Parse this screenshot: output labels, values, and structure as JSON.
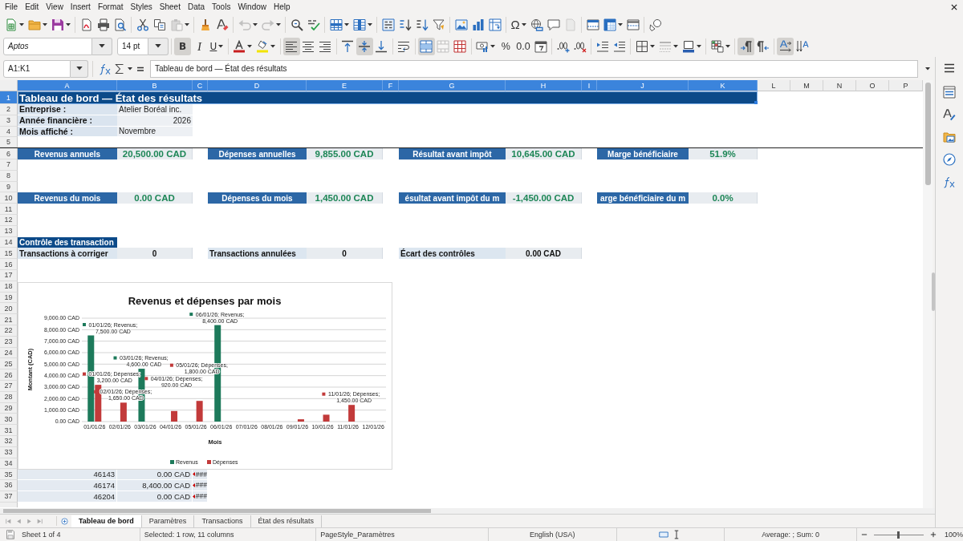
{
  "menu_bar": {
    "items": [
      "File",
      "Edit",
      "View",
      "Insert",
      "Format",
      "Styles",
      "Sheet",
      "Data",
      "Tools",
      "Window",
      "Help"
    ]
  },
  "standard_toolbar": {
    "buttons": [
      {
        "disabled": false
      },
      {
        "disabled": false
      },
      {
        "disabled": false
      },
      {
        "disabled": false
      },
      {
        "disabled": false
      },
      {
        "disabled": false
      },
      {
        "disabled": false
      },
      {
        "disabled": false
      },
      {
        "disabled": true
      },
      {
        "disabled": false
      },
      {
        "disabled": false
      },
      {
        "disabled": true
      },
      {
        "disabled": true
      },
      {
        "disabled": false
      },
      {
        "disabled": false
      },
      {
        "disabled": false
      },
      {
        "disabled": false
      },
      {
        "disabled": false
      },
      {
        "disabled": false
      },
      {
        "disabled": false
      },
      {
        "disabled": false
      },
      {
        "disabled": false
      },
      {
        "disabled": false
      },
      {
        "disabled": false
      },
      {
        "label": "Ω",
        "disabled": false
      },
      {
        "disabled": false
      },
      {
        "disabled": false
      },
      {
        "disabled": true
      },
      {
        "disabled": false
      },
      {
        "disabled": false
      },
      {
        "disabled": false
      },
      {
        "disabled": false
      }
    ]
  },
  "formatting_toolbar": {
    "font_name": "Aptos",
    "font_size": "14 pt",
    "buttons": [
      {
        "label": "B",
        "on": true,
        "disabled": false
      },
      {
        "label": "I",
        "on": false,
        "disabled": false
      },
      {
        "label": "U",
        "on": false,
        "disabled": false
      },
      {
        "on": false,
        "disabled": false
      },
      {
        "on": false,
        "disabled": false
      },
      {
        "on": true,
        "disabled": false
      },
      {
        "on": false,
        "disabled": false
      },
      {
        "on": false,
        "disabled": false
      },
      {
        "on": false,
        "disabled": false
      },
      {
        "on": true,
        "disabled": false
      },
      {
        "on": false,
        "disabled": false
      },
      {
        "on": false,
        "disabled": false
      },
      {
        "on": true,
        "disabled": false
      },
      {
        "on": false,
        "disabled": true
      },
      {
        "on": false,
        "disabled": false
      },
      {
        "on": false,
        "disabled": false
      },
      {
        "label": "%",
        "on": false,
        "disabled": false
      },
      {
        "label": "0.0",
        "on": false,
        "disabled": false
      },
      {
        "on": false,
        "disabled": false
      },
      {
        "on": false,
        "disabled": false
      },
      {
        "on": false,
        "disabled": false
      },
      {
        "on": false,
        "disabled": false
      },
      {
        "on": false,
        "disabled": false
      },
      {
        "on": false,
        "disabled": false
      },
      {
        "on": false,
        "disabled": true
      },
      {
        "on": false,
        "disabled": false
      },
      {
        "on": false,
        "disabled": false
      },
      {
        "on": true,
        "disabled": false
      },
      {
        "on": false,
        "disabled": false
      },
      {
        "on": true,
        "disabled": false
      },
      {
        "on": false,
        "disabled": false
      }
    ]
  },
  "formula_bar": {
    "name_box": "A1:K1",
    "content": "Tableau de bord — État des résultats"
  },
  "sheet": {
    "columns": [
      {
        "label": "A",
        "selected": true
      },
      {
        "label": "B",
        "selected": true
      },
      {
        "label": "C",
        "selected": true
      },
      {
        "label": "D",
        "selected": true
      },
      {
        "label": "E",
        "selected": true
      },
      {
        "label": "F",
        "selected": true
      },
      {
        "label": "G",
        "selected": true
      },
      {
        "label": "H",
        "selected": true
      },
      {
        "label": "I",
        "selected": true
      },
      {
        "label": "J",
        "selected": true
      },
      {
        "label": "K",
        "selected": true
      },
      {
        "label": "L",
        "selected": false
      },
      {
        "label": "M",
        "selected": false
      },
      {
        "label": "N",
        "selected": false
      },
      {
        "label": "O",
        "selected": false
      },
      {
        "label": "P",
        "selected": false
      }
    ],
    "rows": [
      {
        "label": "1",
        "selected": true
      },
      {
        "label": "2",
        "selected": false
      },
      {
        "label": "3",
        "selected": false
      },
      {
        "label": "4",
        "selected": false
      },
      {
        "label": "5",
        "selected": false
      },
      {
        "label": "6",
        "selected": false
      },
      {
        "label": "7",
        "selected": false
      },
      {
        "label": "8",
        "selected": false
      },
      {
        "label": "9",
        "selected": false
      },
      {
        "label": "10",
        "selected": false
      },
      {
        "label": "11",
        "selected": false
      },
      {
        "label": "12",
        "selected": false
      },
      {
        "label": "13",
        "selected": false
      },
      {
        "label": "14",
        "selected": false
      },
      {
        "label": "15",
        "selected": false
      },
      {
        "label": "16",
        "selected": false
      },
      {
        "label": "17",
        "selected": false
      },
      {
        "label": "18",
        "selected": false
      },
      {
        "label": "19",
        "selected": false
      },
      {
        "label": "20",
        "selected": false
      },
      {
        "label": "21",
        "selected": false
      },
      {
        "label": "22",
        "selected": false
      },
      {
        "label": "23",
        "selected": false
      },
      {
        "label": "24",
        "selected": false
      },
      {
        "label": "25",
        "selected": false
      },
      {
        "label": "26",
        "selected": false
      },
      {
        "label": "27",
        "selected": false
      },
      {
        "label": "28",
        "selected": false
      },
      {
        "label": "29",
        "selected": false
      },
      {
        "label": "30",
        "selected": false
      },
      {
        "label": "31",
        "selected": false
      },
      {
        "label": "32",
        "selected": false
      },
      {
        "label": "33",
        "selected": false
      },
      {
        "label": "34",
        "selected": false
      },
      {
        "label": "35",
        "selected": false
      },
      {
        "label": "36",
        "selected": false
      },
      {
        "label": "37",
        "selected": false
      }
    ],
    "title": {
      "text": "Tableau de bord — État des résultats",
      "selected": true
    },
    "info": [
      {
        "label": "Entreprise :",
        "value": "Atelier Boréal inc.",
        "kind": "text"
      },
      {
        "label": "Année financière :",
        "value": "2026",
        "kind": "number"
      },
      {
        "label": "Mois affiché :",
        "value": "Novembre",
        "kind": "text"
      }
    ],
    "kpi_rows": [
      {
        "items": [
          {
            "label": "Revenus annuels",
            "value": "20,500.00 CAD"
          },
          {
            "label": "Dépenses annuelles",
            "value": "9,855.00 CAD"
          },
          {
            "label": "Résultat avant impôt",
            "value": "10,645.00 CAD"
          },
          {
            "label": "Marge bénéficiaire",
            "value": "51.9%"
          }
        ]
      },
      {
        "items": [
          {
            "label": "Revenus du mois",
            "value": "0.00 CAD"
          },
          {
            "label": "Dépenses du mois",
            "value": "1,450.00 CAD"
          },
          {
            "label": "ésultat avant impôt du m",
            "value": "-1,450.00 CAD"
          },
          {
            "label": "arge bénéficiaire du m",
            "value": "0.0%"
          }
        ]
      }
    ],
    "checks": {
      "title": "Contrôle des transaction",
      "items": [
        {
          "label": "Transactions à corriger",
          "value": "0"
        },
        {
          "label": "Transactions annulées",
          "value": "0"
        },
        {
          "label": "Écart des contrôles",
          "value": "0.00 CAD"
        }
      ]
    },
    "chart": {
      "chart_data": {
        "type": "bar",
        "title": "Revenus et dépenses par mois",
        "xlabel": "Mois",
        "ylabel": "Montant (CAD)",
        "categories": [
          "01/01/26",
          "02/01/26",
          "03/01/26",
          "04/01/26",
          "05/01/26",
          "06/01/26",
          "07/01/26",
          "08/01/26",
          "09/01/26",
          "10/01/26",
          "11/01/26",
          "12/01/26"
        ],
        "series": [
          {
            "name": "Revenus",
            "color": "#1d7a5b",
            "values": [
              7500,
              0,
              4600,
              0,
              0,
              8400,
              0,
              0,
              0,
              0,
              0,
              0
            ],
            "value_labels": [
              [
                "01/01/26; Revenus;",
                "7,500.00 CAD"
              ],
              null,
              [
                "03/01/26; Revenus;",
                "4,600.00 CAD"
              ],
              null,
              null,
              [
                "06/01/26; Revenus;",
                "8,400.00 CAD"
              ],
              null,
              null,
              null,
              null,
              null,
              null
            ]
          },
          {
            "name": "Dépenses",
            "color": "#c23a3a",
            "values": [
              3200,
              1650,
              0,
              920,
              1800,
              0,
              0,
              0,
              200,
              600,
              1450,
              0
            ],
            "value_labels": [
              [
                "01/01/26; Dépenses;",
                "3,200.00 CAD"
              ],
              [
                "02/01/26; Dépenses;",
                "1,650.00 CAD"
              ],
              null,
              [
                "04/01/26; Dépenses;",
                "920.00 CAD"
              ],
              [
                "05/01/26; Dépenses;",
                "1,800.00 CAD"
              ],
              null,
              null,
              null,
              null,
              null,
              [
                "11/01/26; Dépenses;",
                "1,450.00 CAD"
              ],
              null
            ]
          }
        ],
        "ylim": [
          0,
          9000
        ],
        "yticks": [
          {
            "value": 0,
            "label": "0.00 CAD"
          },
          {
            "value": 1000,
            "label": "1,000.00 CAD"
          },
          {
            "value": 2000,
            "label": "2,000.00 CAD"
          },
          {
            "value": 3000,
            "label": "3,000.00 CAD"
          },
          {
            "value": 4000,
            "label": "4,000.00 CAD"
          },
          {
            "value": 5000,
            "label": "5,000.00 CAD"
          },
          {
            "value": 6000,
            "label": "6,000.00 CAD"
          },
          {
            "value": 7000,
            "label": "7,000.00 CAD"
          },
          {
            "value": 8000,
            "label": "8,000.00 CAD"
          },
          {
            "value": 9000,
            "label": "9,000.00 CAD"
          }
        ],
        "grid": true,
        "legend": "bottom"
      }
    },
    "data_rows": [
      {
        "cells": [
          {
            "text": "46143",
            "overflow": false
          },
          {
            "text": "0.00 CAD",
            "overflow": false
          },
          {
            "text": "###",
            "overflow": true
          }
        ]
      },
      {
        "cells": [
          {
            "text": "46174",
            "overflow": false
          },
          {
            "text": "8,400.00 CAD",
            "overflow": false
          },
          {
            "text": "###",
            "overflow": true
          }
        ]
      },
      {
        "cells": [
          {
            "text": "46204",
            "overflow": false
          },
          {
            "text": "0.00 CAD",
            "overflow": false
          },
          {
            "text": "###",
            "overflow": true
          }
        ]
      }
    ]
  },
  "sheet_tabs": [
    {
      "label": "Tableau de bord",
      "selected": true
    },
    {
      "label": "Paramètres",
      "selected": false
    },
    {
      "label": "Transactions",
      "selected": false
    },
    {
      "label": "État des résultats",
      "selected": false
    }
  ],
  "status_bar": {
    "sheet": "Sheet 1 of 4",
    "selection": "Selected: 1 row, 11 columns",
    "page_style": "PageStyle_Paramètres",
    "language": "English (USA)",
    "summary": "Average: ; Sum: 0",
    "zoom_slider": {
      "level": 0.5
    },
    "zoom": "100%"
  }
}
